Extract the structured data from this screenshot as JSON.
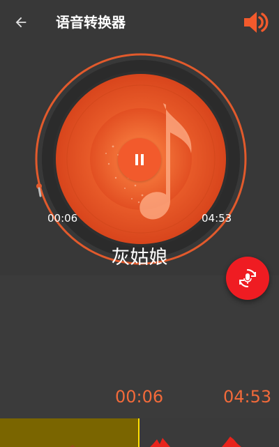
{
  "appbar": {
    "title": "语音转换器",
    "back_icon": "arrow-left-icon",
    "volume_icon": "volume-icon"
  },
  "player": {
    "song_title": "灰姑娘",
    "current_time": "00:06",
    "total_time": "04:53",
    "progress": 0.02,
    "state": "playing",
    "pause_icon": "pause-icon"
  },
  "fab": {
    "icon": "voice-convert-icon"
  },
  "waveform": {
    "current_time": "00:06",
    "total_time": "04:53",
    "played_color": "#7a6500",
    "cursor_color": "#ffe100",
    "wave_color": "#e8231b"
  },
  "colors": {
    "accent": "#f25a2c",
    "fab": "#ef1c22",
    "time_text": "#f26a3a",
    "background": "#383838"
  }
}
